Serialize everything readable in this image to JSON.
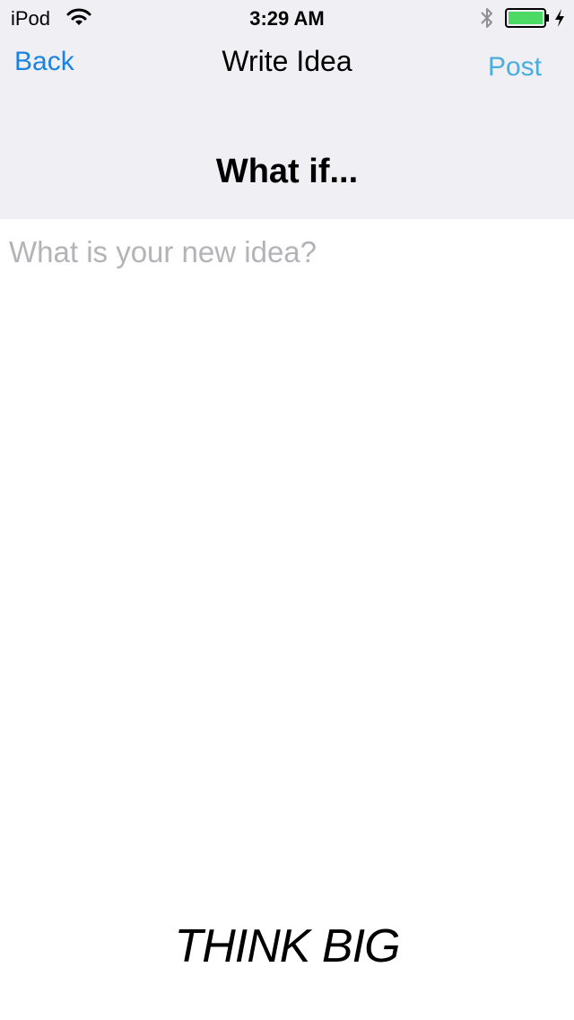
{
  "status_bar": {
    "carrier": "iPod",
    "time": "3:29 AM",
    "icons": [
      "wifi-icon",
      "bluetooth-icon",
      "battery-icon",
      "charging-bolt-icon"
    ],
    "battery_color": "#4cd964"
  },
  "nav": {
    "back_label": "Back",
    "title": "Write Idea",
    "post_label": "Post"
  },
  "heading": "What if...",
  "idea_input": {
    "value": "",
    "placeholder": "What is your new idea?"
  },
  "footer": {
    "text": "THINK BIG"
  },
  "colors": {
    "header_background": "#efeff4",
    "back_link": "#1a82e2",
    "post_link": "#4aaddc",
    "placeholder": "#b3b3b8"
  }
}
